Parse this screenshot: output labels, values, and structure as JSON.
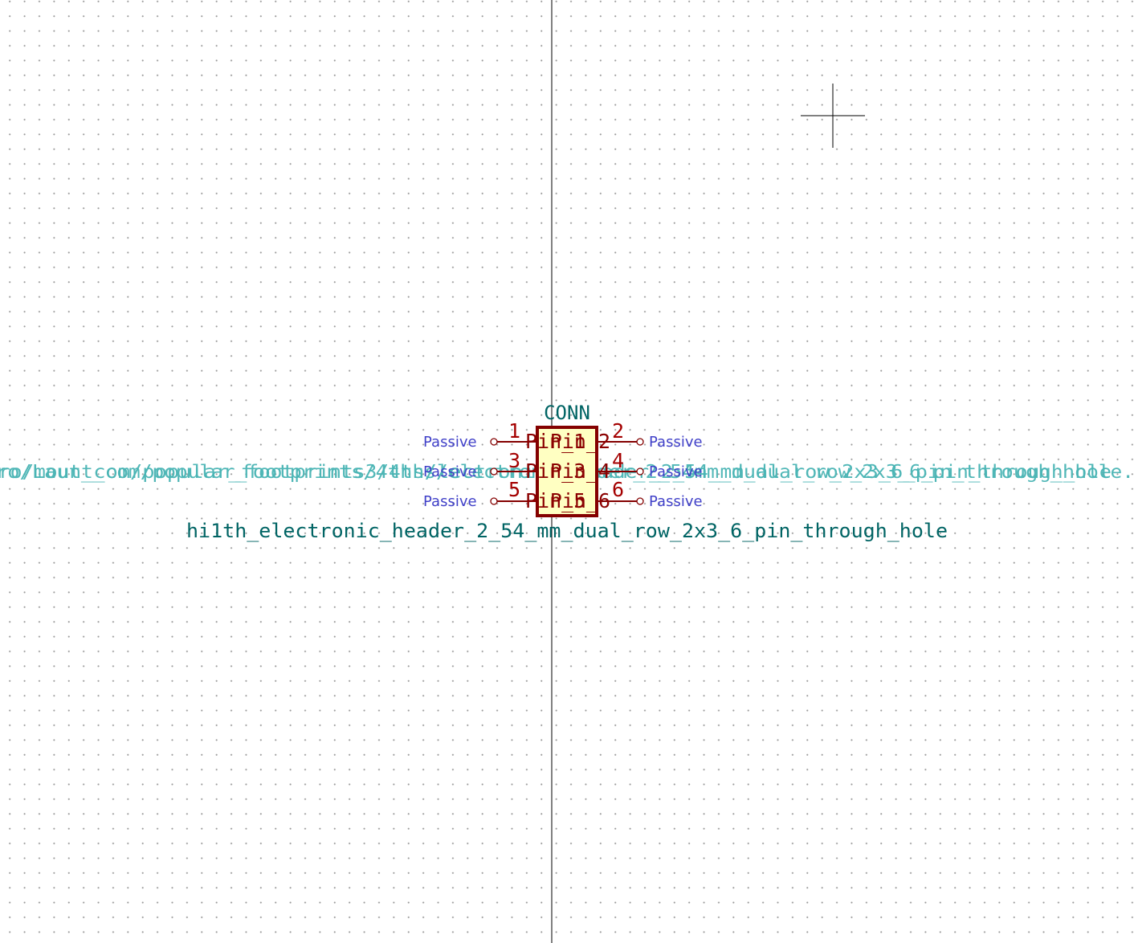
{
  "symbol": {
    "reference": "CONN",
    "value": "hi1th_electronic_header_2_54_mm_dual_row_2x3_6_pin_through_hole",
    "footprint": "ro/mount_com/popular_footprints3/4ths/electronic_header_2_54_mm_dual_row_2x3_6_pin_through_hole.",
    "footprint_overlay": "ro/Laut_com/popular_footprints/4ths/lectronic_header_2_54mm_dual_row_2x3_6_pin_through_hole",
    "pin_type_label": "Passive",
    "pins": [
      {
        "number": "1",
        "name": "Pin_1"
      },
      {
        "number": "2",
        "name": "Pin_2"
      },
      {
        "number": "3",
        "name": "Pin_3"
      },
      {
        "number": "4",
        "name": "Pin_4"
      },
      {
        "number": "5",
        "name": "Pin_5"
      },
      {
        "number": "6",
        "name": "Pin_6"
      }
    ]
  },
  "colors": {
    "body_fill": "#ffffc2",
    "body_outline": "#840000",
    "pin": "#840000",
    "field": "#006464",
    "electrical_type": "#4040c8",
    "axis": "#000000"
  }
}
